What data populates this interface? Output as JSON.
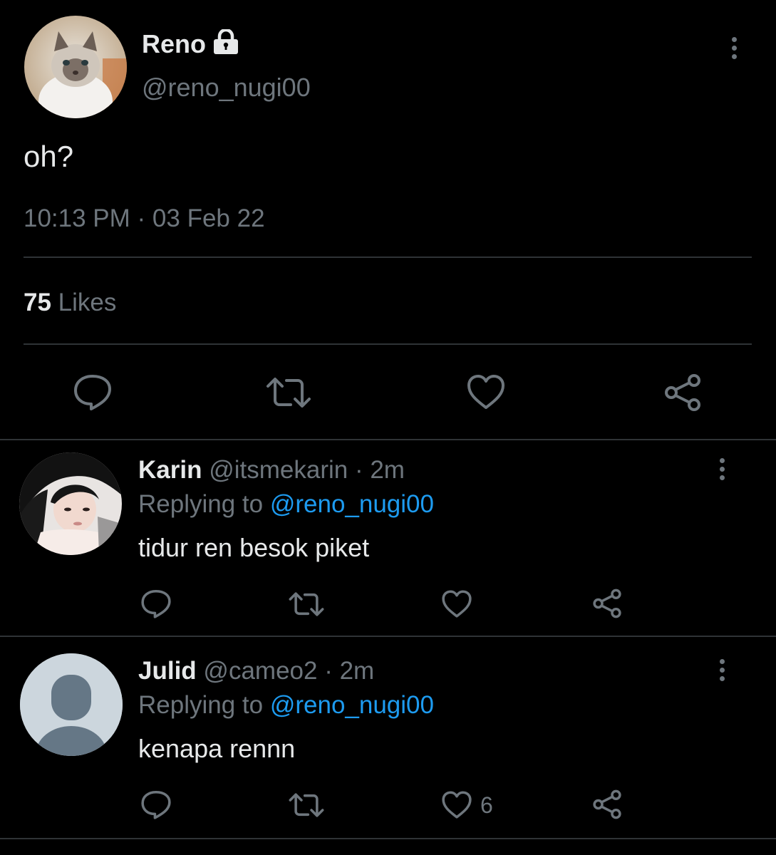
{
  "main_tweet": {
    "display_name": "Reno",
    "handle": "@reno_nugi00",
    "text": "oh?",
    "time": "10:13 PM",
    "separator": " · ",
    "date": "03 Feb 22",
    "likes_count": "75",
    "likes_label": "Likes",
    "protected_icon": "lock-icon"
  },
  "replies": [
    {
      "display_name": "Karin",
      "handle": "@itsmekarin",
      "age": " · 2m",
      "replying_label": "Replying to ",
      "replying_to": "@reno_nugi00",
      "text": "tidur ren besok piket",
      "like_count": ""
    },
    {
      "display_name": "Julid",
      "handle": "@cameo2",
      "age": " · 2m",
      "replying_label": "Replying to ",
      "replying_to": "@reno_nugi00",
      "text": "kenapa rennn",
      "like_count": "6"
    }
  ],
  "colors": {
    "background": "#000000",
    "text": "#e7e9ea",
    "muted": "#6e767d",
    "link": "#1d9bf0",
    "divider": "#2f3336"
  },
  "icons": [
    "reply-icon",
    "retweet-icon",
    "like-icon",
    "share-icon",
    "more-icon"
  ]
}
